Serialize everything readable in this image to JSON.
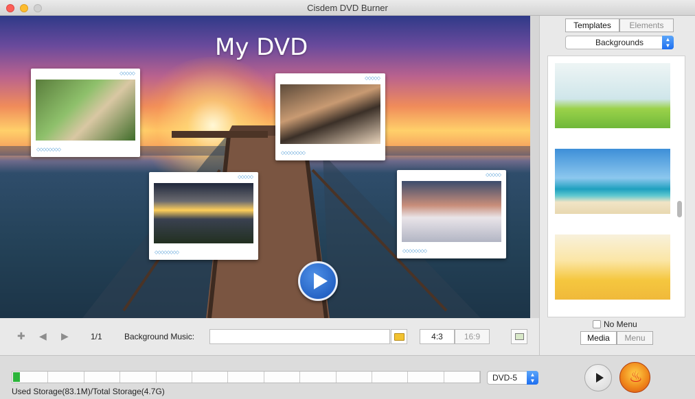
{
  "window": {
    "title": "Cisdem DVD Burner"
  },
  "preview": {
    "menu_title": "My DVD",
    "frame_dots": "◇◇◇◇◇",
    "frame_caption": "◇◇◇◇◇◇◇◇"
  },
  "toolbar": {
    "page_indicator": "1/1",
    "background_music_label": "Background Music:",
    "background_music_value": "",
    "ratio_options": [
      "4:3",
      "16:9"
    ],
    "ratio_selected": "4:3"
  },
  "right_panel": {
    "tabs": [
      "Templates",
      "Elements"
    ],
    "active_tab": "Templates",
    "category": "Backgrounds",
    "no_menu_label": "No Menu",
    "no_menu_checked": false,
    "mode_tabs": [
      "Media",
      "Menu"
    ],
    "active_mode": "Media"
  },
  "bottom": {
    "storage_text": "Used Storage(83.1M)/Total Storage(4.7G)",
    "storage_used_fraction": 0.018,
    "disc_type": "DVD-5"
  },
  "icons": [
    "plus-icon",
    "arrow-left-icon",
    "arrow-right-icon",
    "folder-icon",
    "add-media-icon",
    "play-icon",
    "burn-icon"
  ]
}
